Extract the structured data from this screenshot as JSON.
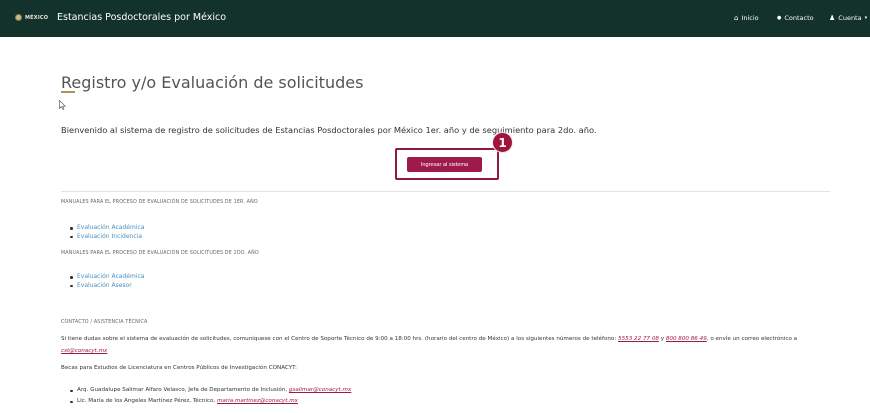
{
  "header": {
    "logo_text": "MÉXICO",
    "brand": "Estancias Posdoctorales por México",
    "nav": [
      {
        "icon": "home-icon",
        "glyph": "⌂",
        "label": "Inicio"
      },
      {
        "icon": "chat-icon",
        "glyph": "●",
        "label": "Contacto"
      },
      {
        "icon": "user-icon",
        "glyph": "♟",
        "label": "Cuenta",
        "caret": "▾"
      }
    ]
  },
  "main": {
    "title": "Registro y/o Evaluación de solicitudes",
    "welcome": "Bienvenido al sistema de registro de solicitudes de Estancias Posdoctorales por México 1er. año y de seguimiento para 2do. año.",
    "enter_button": "Ingresar al sistema",
    "step_badge": "1"
  },
  "manuals": [
    {
      "heading": "MANUALES PARA EL PROCESO DE EVALUACIÓN DE SOLICITUDES DE 1ER. AÑO",
      "links": [
        "Evaluación Académica",
        "Evaluación Incidencia"
      ]
    },
    {
      "heading": "MANUALES PARA EL PROCESO DE EVALUACIÓN DE SOLICITUDES DE 2DO. AÑO",
      "links": [
        "Evaluación Académica",
        "Evaluación Asesor"
      ]
    }
  ],
  "contact": {
    "heading": "CONTACTO / ASISTENCIA TÉCNICA",
    "text_1": "Si tiene dudas sobre el sistema de evaluación de solicitudes, comuníquese con el Centro de Soporte Técnico de 9:00 a 18:00 hrs. (horario del centro de México) a los siguientes números de teléfono: ",
    "phone_1": "5553 22 77 08",
    "and": " y ",
    "phone_2": "800 800 86 49",
    "text_2": ", o envíe un correo electrónico a ",
    "email": "cst@conacyt.mx",
    "becas_text": "Becas para Estudios de Licenciatura en Centros Públicos de Investigación CONACYT:",
    "people": [
      {
        "text": "Arq. Guadalupe Salimar Alfaro Velasco, Jefa de Departamento de Inclusión, ",
        "email": "gsalimar@conacyt.mx"
      },
      {
        "text": "Lic. María de los Angeles Martínez Pérez, Técnico, ",
        "email": "maria.martinez@conacyt.mx"
      }
    ]
  },
  "colors": {
    "header_bg": "#13322b",
    "accent_gold": "#b38e5d",
    "button_bg": "#9d1a4b",
    "link_blue": "#4a8ec2"
  }
}
